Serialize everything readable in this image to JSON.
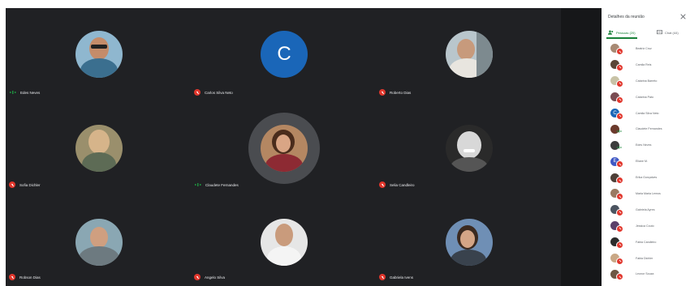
{
  "meeting": {
    "participants": [
      {
        "name": "Edes Neves",
        "status": "speaking",
        "avatar": "photo-man-sunglasses"
      },
      {
        "name": "Carlos Silva Neto",
        "status": "muted",
        "avatar": "initial",
        "initial": "C"
      },
      {
        "name": "Roberto Dias",
        "status": "muted",
        "avatar": "photo-man-car"
      },
      {
        "name": "Sofia Dichler",
        "status": "muted",
        "avatar": "photo-woman-blonde"
      },
      {
        "name": "Claudete Fernandes",
        "status": "speaking",
        "avatar": "photo-woman-brunette",
        "highlighted": true
      },
      {
        "name": "Selia Candleiro",
        "status": "muted",
        "avatar": "photo-woman-bw"
      },
      {
        "name": "Robson Dias",
        "status": "muted",
        "avatar": "photo-man-car-2"
      },
      {
        "name": "Angelo Silva",
        "status": "muted",
        "avatar": "photo-young-man"
      },
      {
        "name": "Gabriela Ivens",
        "status": "muted",
        "avatar": "photo-woman-outdoor"
      }
    ]
  },
  "panel": {
    "title": "Detalhes da reunião",
    "close_icon": "close-icon",
    "tab_people": "Pessoas (20)",
    "tab_chat": "Chat (44)",
    "people": [
      {
        "name": "Beatriz Cruz",
        "status": "muted"
      },
      {
        "name": "Camila Reis",
        "status": "muted"
      },
      {
        "name": "Catarina Barreto",
        "status": "muted"
      },
      {
        "name": "Catarina Pato",
        "status": "muted"
      },
      {
        "name": "Camila Silva Neto",
        "status": "muted",
        "initial": "C"
      },
      {
        "name": "Claudete Fernandes",
        "status": "speaking"
      },
      {
        "name": "Edes Neves",
        "status": "speaking"
      },
      {
        "name": "Eliane M.",
        "status": "muted",
        "initial": "E"
      },
      {
        "name": "Erika Gonçalves",
        "status": "muted"
      },
      {
        "name": "Maria Maria Lemos",
        "status": "muted"
      },
      {
        "name": "Gabriela Ayres",
        "status": "muted"
      },
      {
        "name": "Jessica Couto",
        "status": "muted"
      },
      {
        "name": "Fabia Candleiro",
        "status": "muted"
      },
      {
        "name": "Fabia Dichler",
        "status": "muted"
      },
      {
        "name": "Leonor Souza",
        "status": "muted"
      }
    ]
  },
  "colors": {
    "stage": "#202124",
    "muted": "#e1362c",
    "speaking": "#1e8e3e",
    "accent": "#188038"
  }
}
